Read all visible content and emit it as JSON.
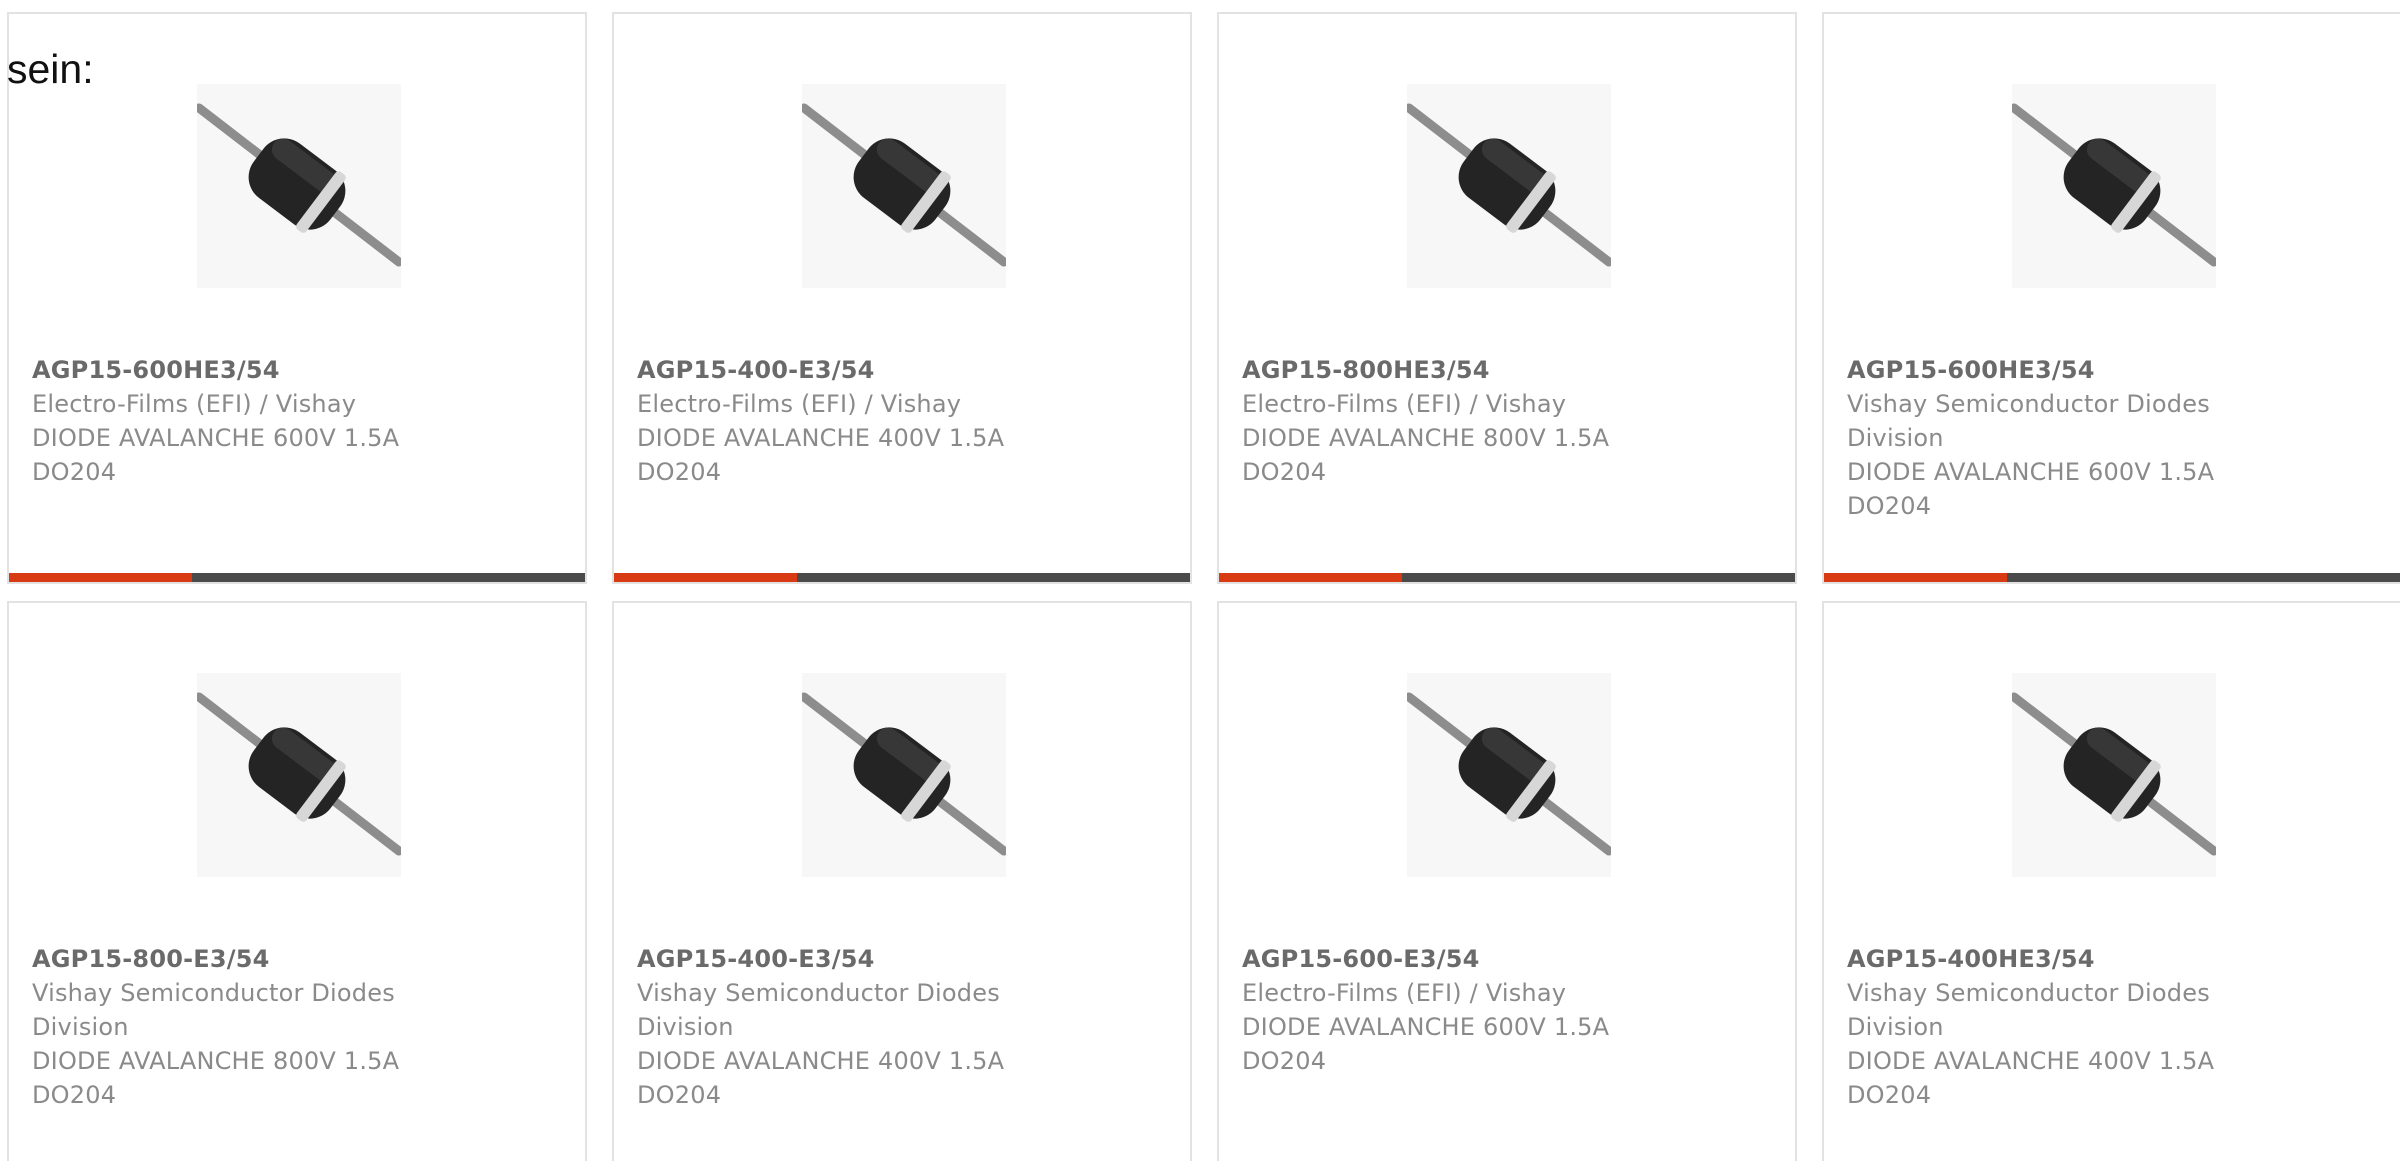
{
  "intro_text": "sein:",
  "colors": {
    "accent": "#d83a13",
    "bar_track": "#4a4a4a",
    "card_border": "#e2e2e2",
    "muted_text": "#8a8a8a",
    "part_text": "#6a6a6a"
  },
  "products": [
    {
      "image_icon": "axial-diode-icon",
      "part_number": "AGP15-600HE3/54",
      "manufacturer": "Electro-Films (EFI) / Vishay",
      "description": "DIODE AVALANCHE 600V 1.5A DO204",
      "progress_fraction": 0.318
    },
    {
      "image_icon": "axial-diode-icon",
      "part_number": "AGP15-400-E3/54",
      "manufacturer": "Electro-Films (EFI) / Vishay",
      "description": "DIODE AVALANCHE 400V 1.5A DO204",
      "progress_fraction": 0.318
    },
    {
      "image_icon": "axial-diode-icon",
      "part_number": "AGP15-800HE3/54",
      "manufacturer": "Electro-Films (EFI) / Vishay",
      "description": "DIODE AVALANCHE 800V 1.5A DO204",
      "progress_fraction": 0.318
    },
    {
      "image_icon": "axial-diode-icon",
      "part_number": "AGP15-600HE3/54",
      "manufacturer": "Vishay Semiconductor Diodes Division",
      "description": "DIODE AVALANCHE 600V 1.5A DO204",
      "progress_fraction": 0.318
    },
    {
      "image_icon": "axial-diode-icon",
      "part_number": "AGP15-800-E3/54",
      "manufacturer": "Vishay Semiconductor Diodes Division",
      "description": "DIODE AVALANCHE 800V 1.5A DO204",
      "progress_fraction": 0
    },
    {
      "image_icon": "axial-diode-icon",
      "part_number": "AGP15-400-E3/54",
      "manufacturer": "Vishay Semiconductor Diodes Division",
      "description": "DIODE AVALANCHE 400V 1.5A DO204",
      "progress_fraction": 0
    },
    {
      "image_icon": "axial-diode-icon",
      "part_number": "AGP15-600-E3/54",
      "manufacturer": "Electro-Films (EFI) / Vishay",
      "description": "DIODE AVALANCHE 600V 1.5A DO204",
      "progress_fraction": 0
    },
    {
      "image_icon": "axial-diode-icon",
      "part_number": "AGP15-400HE3/54",
      "manufacturer": "Vishay Semiconductor Diodes Division",
      "description": "DIODE AVALANCHE 400V 1.5A DO204",
      "progress_fraction": 0
    }
  ]
}
